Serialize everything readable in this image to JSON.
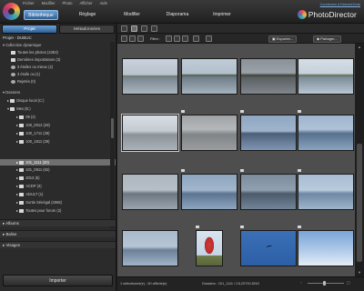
{
  "menubar": [
    "Fichier",
    "Modifier",
    "Photo",
    "Afficher",
    "Aide"
  ],
  "login": "Connexion à DirectorZone",
  "modes": [
    {
      "label": "Bibliothèque",
      "active": true
    },
    {
      "label": "Réglage",
      "active": false
    },
    {
      "label": "Modifier",
      "active": false
    },
    {
      "label": "Diaporama",
      "active": false
    },
    {
      "label": "Imprimer",
      "active": false
    }
  ],
  "brand": "PhotoDirector",
  "left": {
    "tabs": [
      {
        "label": "Projet",
        "active": true
      },
      {
        "label": "Métadonnées",
        "active": false
      }
    ],
    "project_title": "Projet - DUBUC",
    "collection_header": "Collection dynamique",
    "collections": [
      {
        "label": "Toutes les photos (4353)",
        "icon": "folder-icon"
      },
      {
        "label": "Dernières importations (3)",
        "icon": "folder-icon"
      },
      {
        "label": "3 étoiles ou mieux (2)",
        "icon": "star-icon"
      },
      {
        "label": "3 étoile ou (1)",
        "icon": "star-icon"
      },
      {
        "label": "Rejetés (0)",
        "icon": "reject-icon"
      }
    ],
    "folders_header": "Dossiers",
    "folders": [
      {
        "label": "Disque local (C:)",
        "level": 1
      },
      {
        "label": "Mes (E:)",
        "level": 1
      },
      {
        "label": "09 (2)",
        "level": 2
      },
      {
        "label": "100_0012 (28)",
        "level": 2
      },
      {
        "label": "100_1711 (28)",
        "level": 2
      },
      {
        "label": "100_1811 (29)",
        "level": 2
      },
      {
        "label": "101_1111 (20)",
        "level": 2,
        "selected": true
      },
      {
        "label": "101_0811 (62)",
        "level": 2
      },
      {
        "label": "2013 (5)",
        "level": 2
      },
      {
        "label": "ACDP (3)",
        "level": 2
      },
      {
        "label": "ADULT (1)",
        "level": 2
      },
      {
        "label": "Sortie Sénégal (4066)",
        "level": 2
      },
      {
        "label": "Toutes pour forum (2)",
        "level": 2
      }
    ],
    "sections": [
      "Albums",
      "Balise",
      "Visages"
    ],
    "import_label": "Importer"
  },
  "toolbar": {
    "filter_label": "Filtre :",
    "export_label": "Exporter...",
    "share_label": "Partager..."
  },
  "status": {
    "selection": "1 sélectionné(e) - 60 affiché(e)",
    "path": "Dossiers : 101_1111 / CIL20700.DNG"
  },
  "thumbnails": [
    {
      "style": "lake-mist",
      "selected": false
    },
    {
      "style": "lake-trees",
      "selected": false
    },
    {
      "style": "lake-dark",
      "selected": false
    },
    {
      "style": "lake-bright",
      "selected": false
    },
    {
      "style": "lake-fog",
      "selected": true
    },
    {
      "style": "lake-fog2",
      "selected": false
    },
    {
      "style": "lake-blue",
      "selected": false
    },
    {
      "style": "lake-blue2",
      "selected": false
    },
    {
      "style": "fog-gray",
      "selected": false
    },
    {
      "style": "fog-blue",
      "selected": false
    },
    {
      "style": "fog-dark",
      "selected": false
    },
    {
      "style": "fog-light",
      "selected": false
    },
    {
      "style": "mist-blue",
      "selected": false
    },
    {
      "style": "red-tree",
      "selected": false
    },
    {
      "style": "bird-sky",
      "selected": false
    },
    {
      "style": "clouds",
      "selected": false
    }
  ],
  "colors": {
    "accent": "#4a86c6",
    "panel": "#2b2b2b",
    "grid": "#4e4e4e"
  }
}
